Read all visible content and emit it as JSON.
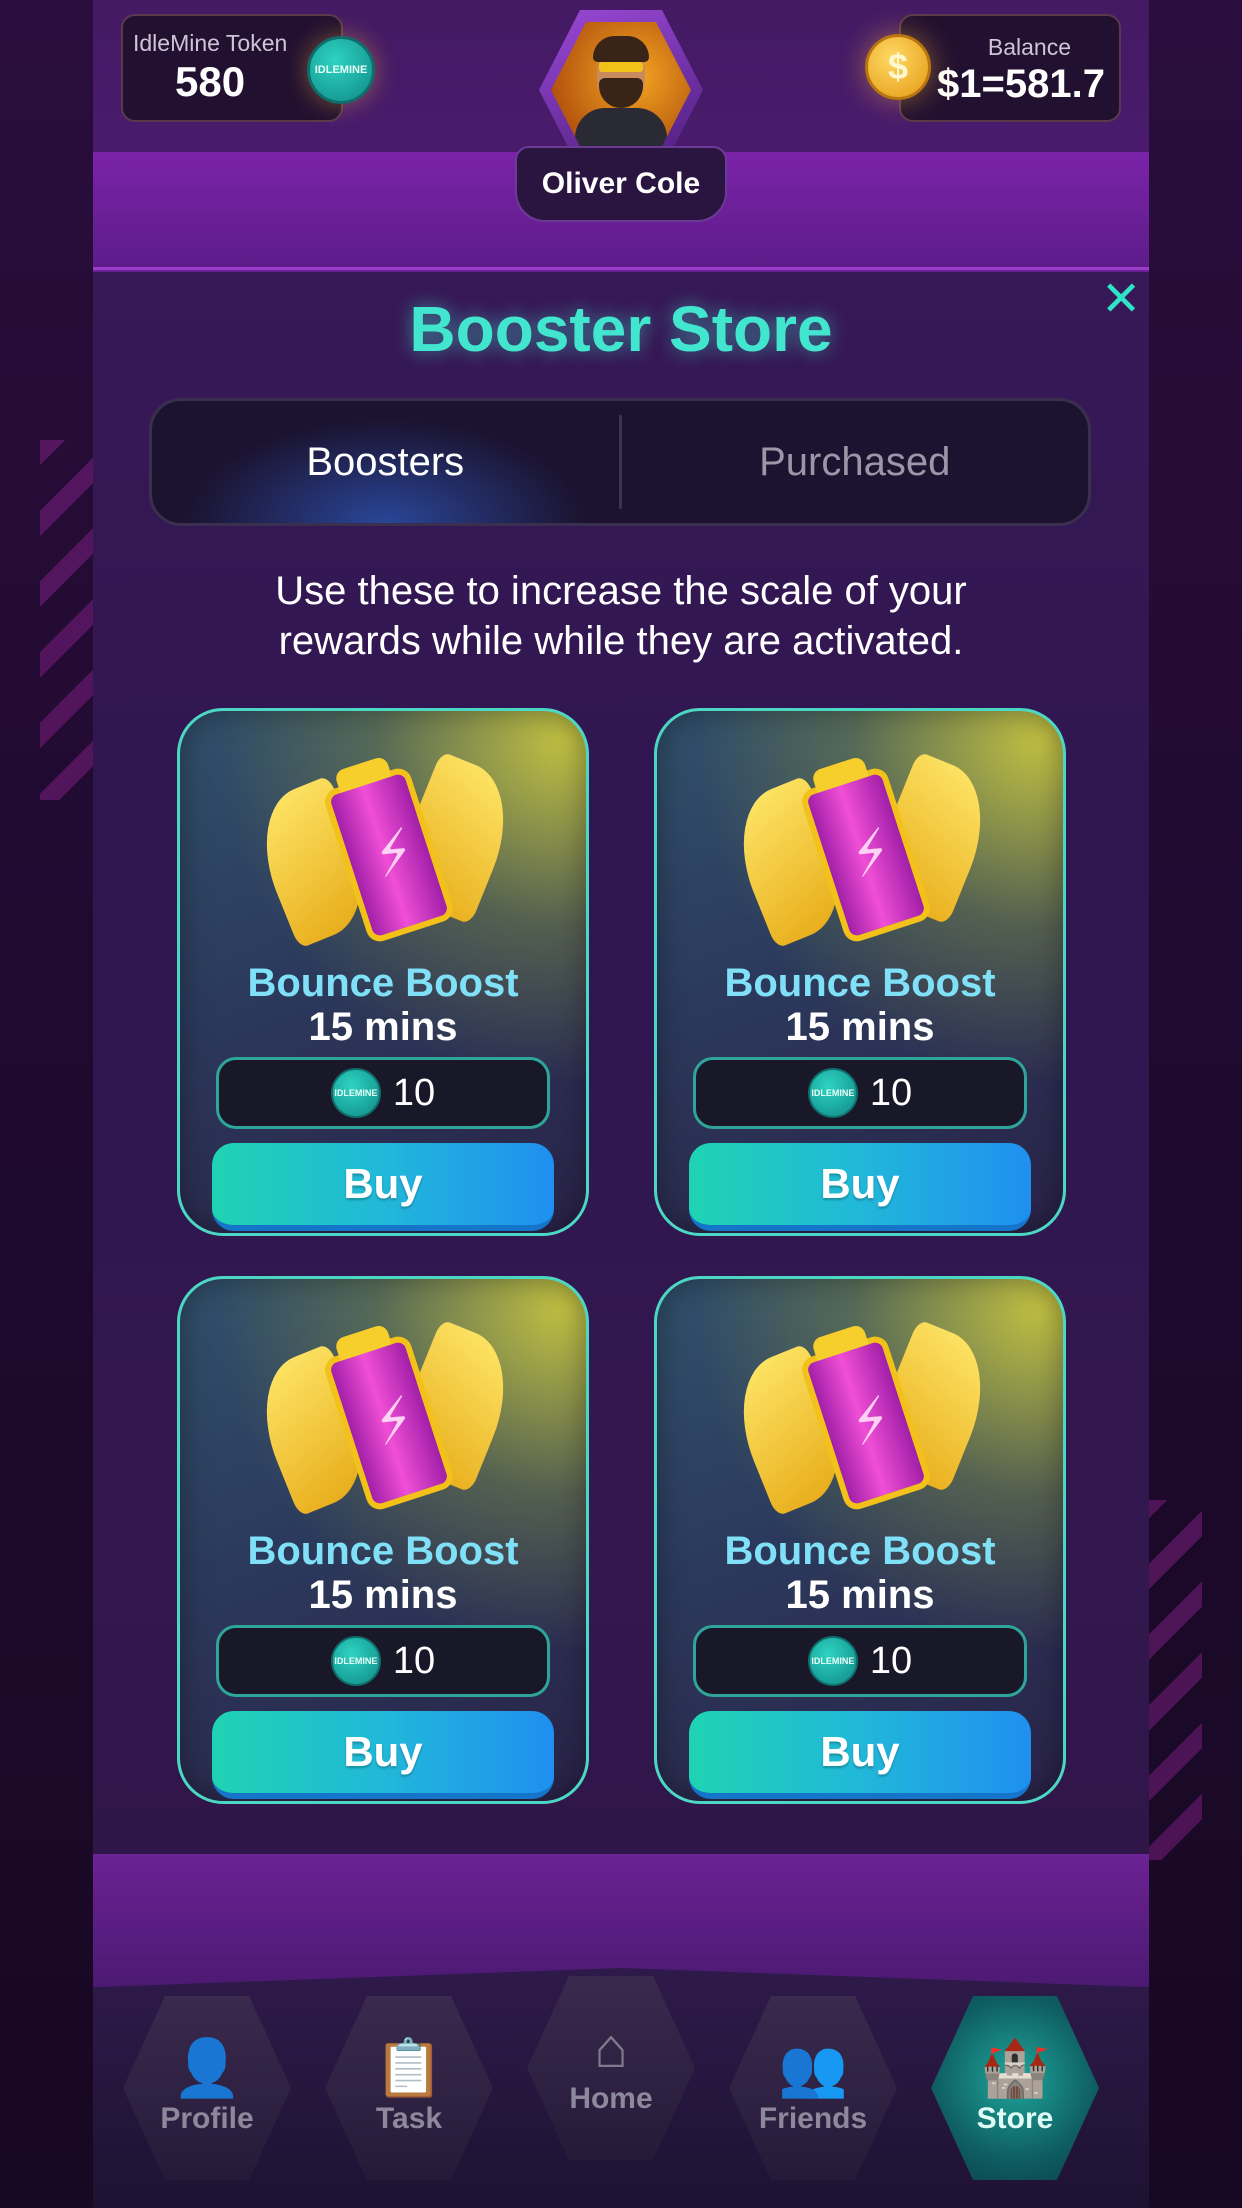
{
  "header": {
    "token_title": "IdleMine Token",
    "token_value": "580",
    "token_icon": "idlemine-coin-icon",
    "token_coin_text": "IDLEMINE",
    "balance_title": "Balance",
    "balance_value": "$1=581.7",
    "balance_icon": "dollar-coin-icon",
    "dollar_symbol": "$",
    "user_name": "Oliver Cole"
  },
  "store": {
    "title": "Booster Store",
    "close_icon": "close-icon",
    "tabs": [
      {
        "label": "Boosters",
        "active": true
      },
      {
        "label": "Purchased",
        "active": false
      }
    ],
    "description": "Use these to increase the scale of your rewards while while they are activated.",
    "cards": [
      {
        "name": "Bounce Boost",
        "duration": "15 mins",
        "price": "10",
        "button": "Buy"
      },
      {
        "name": "Bounce Boost",
        "duration": "15 mins",
        "price": "10",
        "button": "Buy"
      },
      {
        "name": "Bounce Boost",
        "duration": "15 mins",
        "price": "10",
        "button": "Buy"
      },
      {
        "name": "Bounce Boost",
        "duration": "15 mins",
        "price": "10",
        "button": "Buy"
      }
    ]
  },
  "nav": [
    {
      "label": "Profile",
      "icon": "profile-icon",
      "active": false
    },
    {
      "label": "Task",
      "icon": "task-icon",
      "active": false
    },
    {
      "label": "Home",
      "icon": "home-icon",
      "active": false
    },
    {
      "label": "Friends",
      "icon": "friends-icon",
      "active": false
    },
    {
      "label": "Store",
      "icon": "store-icon",
      "active": true
    }
  ],
  "colors": {
    "accent": "#42e6cf",
    "card_title": "#7fe0f7",
    "buy_start": "#1fd3b2",
    "buy_end": "#1f8ff0"
  }
}
